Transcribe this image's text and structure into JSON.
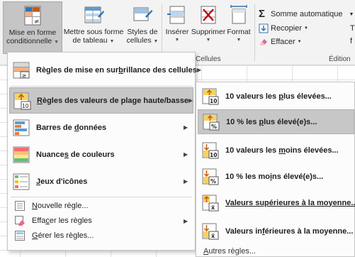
{
  "ribbon": {
    "conditional": {
      "line1": "Mise en forme",
      "line2": "conditionnelle"
    },
    "format_table": {
      "line1": "Mettre sous forme",
      "line2": "de tableau"
    },
    "cell_styles": {
      "line1": "Styles de",
      "line2": "cellules"
    },
    "insert": {
      "label": "Insérer"
    },
    "delete": {
      "label": "Supprimer"
    },
    "format": {
      "label": "Format"
    },
    "cells_group": "Cellules",
    "autosum": "Somme automatique",
    "fill": "Recopier",
    "clear": "Effacer",
    "edit_group": "Édition",
    "edge_letter": "T",
    "edge_letter2": "f"
  },
  "menu": {
    "highlight_rules": {
      "pre": "Règles de mise en sur",
      "key": "b",
      "post": "rillance des cellules"
    },
    "top_bottom_rules": {
      "key": "R",
      "post": "ègles des valeurs de plage haute/basse"
    },
    "data_bars": {
      "pre": "Barres de ",
      "key": "d",
      "post": "onnées"
    },
    "color_scales": {
      "pre": "Nuance",
      "key": "s",
      "post": " de couleurs"
    },
    "icon_sets": {
      "key": "J",
      "post": "eux d'icônes"
    },
    "new_rule": {
      "key": "N",
      "post": "ouvelle règle..."
    },
    "clear_rules": {
      "pre": "Effa",
      "key": "c",
      "post": "er les règles"
    },
    "manage_rules": {
      "key": "G",
      "post": "érer les règles..."
    }
  },
  "submenu": {
    "top10": {
      "pre": "10 valeurs les ",
      "key": "p",
      "post": "lus élevées..."
    },
    "top10pct": {
      "pre": "10 % les ",
      "key": "p",
      "post": "lus élevé(e)s..."
    },
    "bottom10": {
      "pre": "10 valeurs les ",
      "key": "m",
      "post": "oins élevées..."
    },
    "bottom10pct": {
      "pre": "10 % les mo",
      "key": "i",
      "post": "ns élevé(e)s..."
    },
    "above_avg": {
      "key": "V",
      "post": "aleurs supérieures à la moyenne..."
    },
    "below_avg": {
      "pre": "Valeurs in",
      "key": "f",
      "post": "érieures à la moyenne..."
    },
    "more_rules": {
      "key": "A",
      "post": "utres règles..."
    }
  },
  "icons": {
    "conditional": "conditional-formatting-icon",
    "top10": "top-10-icon"
  },
  "colors": {
    "highlight": "#c7c7c7",
    "menu_bg": "#fcfcfc",
    "ribbon_bg": "#f3f3f3"
  }
}
